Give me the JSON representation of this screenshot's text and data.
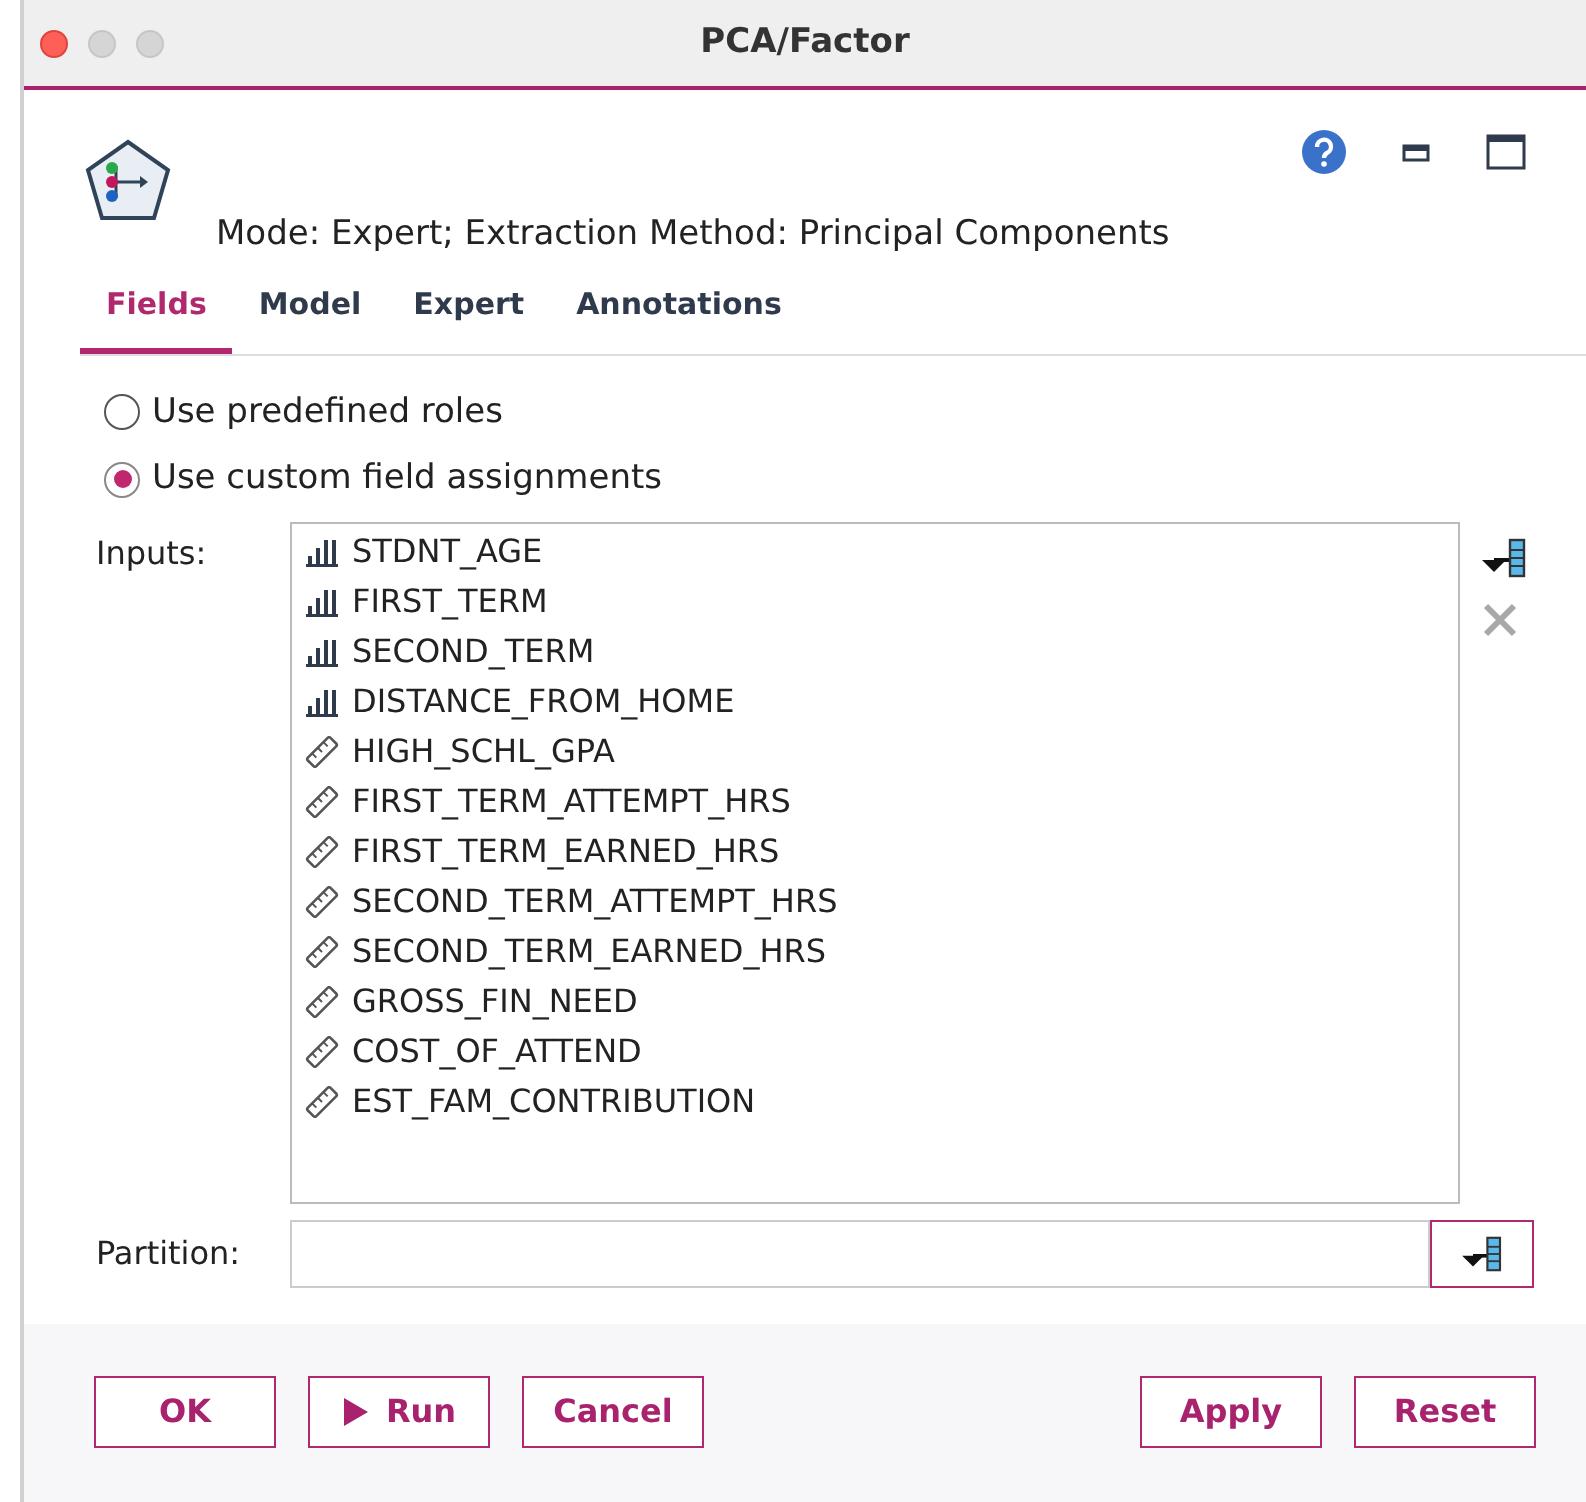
{
  "window": {
    "title": "PCA/Factor"
  },
  "header": {
    "mode_text": "Mode: Expert; Extraction Method: Principal Components"
  },
  "tabs": [
    {
      "label": "Fields",
      "selected": true
    },
    {
      "label": "Model",
      "selected": false
    },
    {
      "label": "Expert",
      "selected": false
    },
    {
      "label": "Annotations",
      "selected": false
    }
  ],
  "radios": [
    {
      "label": "Use predefined roles",
      "selected": false
    },
    {
      "label": "Use custom field assignments",
      "selected": true
    }
  ],
  "inputs": {
    "label": "Inputs:",
    "fields": [
      {
        "name": "STDNT_AGE",
        "kind": "ordinal"
      },
      {
        "name": "FIRST_TERM",
        "kind": "ordinal"
      },
      {
        "name": "SECOND_TERM",
        "kind": "ordinal"
      },
      {
        "name": "DISTANCE_FROM_HOME",
        "kind": "ordinal"
      },
      {
        "name": "HIGH_SCHL_GPA",
        "kind": "continuous"
      },
      {
        "name": "FIRST_TERM_ATTEMPT_HRS",
        "kind": "continuous"
      },
      {
        "name": "FIRST_TERM_EARNED_HRS",
        "kind": "continuous"
      },
      {
        "name": "SECOND_TERM_ATTEMPT_HRS",
        "kind": "continuous"
      },
      {
        "name": "SECOND_TERM_EARNED_HRS",
        "kind": "continuous"
      },
      {
        "name": "GROSS_FIN_NEED",
        "kind": "continuous"
      },
      {
        "name": "COST_OF_ATTEND",
        "kind": "continuous"
      },
      {
        "name": "EST_FAM_CONTRIBUTION",
        "kind": "continuous"
      }
    ]
  },
  "partition": {
    "label": "Partition:"
  },
  "buttons_left": [
    {
      "label": "OK",
      "kind": "plain"
    },
    {
      "label": "Run",
      "kind": "run"
    },
    {
      "label": "Cancel",
      "kind": "plain"
    }
  ],
  "buttons_right": [
    {
      "label": "Apply",
      "kind": "plain"
    },
    {
      "label": "Reset",
      "kind": "plain"
    }
  ]
}
